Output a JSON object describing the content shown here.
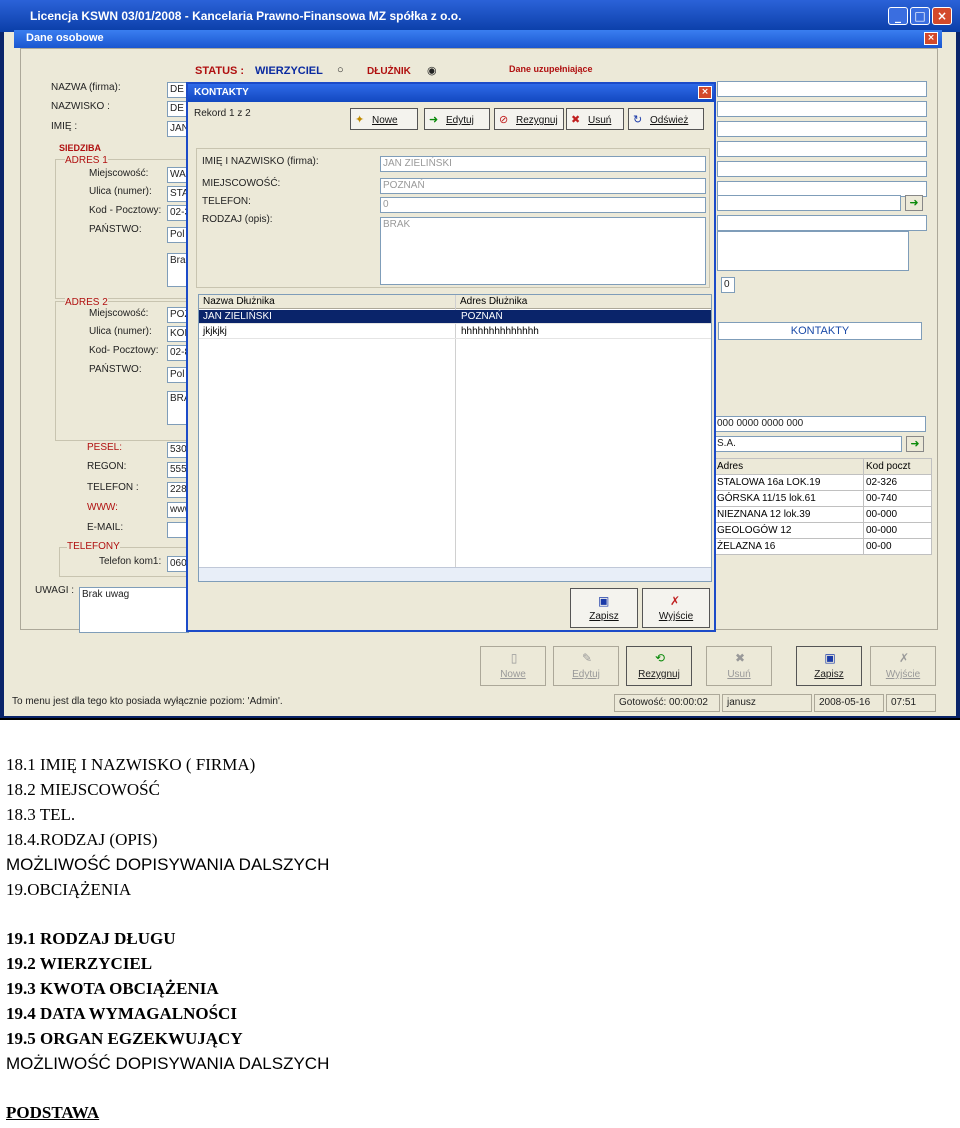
{
  "window": {
    "title": "Licencja KSWN 03/01/2008 - Kancelaria Prawno-Finansowa MZ spółka z o.o.",
    "min": "_",
    "max": "□",
    "close": "×"
  },
  "subwindow": {
    "title": "Dane osobowe",
    "close": "×"
  },
  "form": {
    "status_label": "STATUS :",
    "wierzyciel": "WIERZYCIEL",
    "dluznik": "DŁUŻNIK",
    "dane_uzup": "Dane uzupełniające",
    "nazwa_label": "NAZWA (firma):",
    "nazwa_val": "DE",
    "nazwisko_label": "NAZWISKO :",
    "nazwisko_val": "DE",
    "imie_label": "IMIĘ :",
    "imie_val": "JAN",
    "siedziba": "SIEDZIBA",
    "adres1": "ADRES 1",
    "miejsc_label": "Miejscowość:",
    "miejsc1_val": "WA",
    "ulica_label": "Ulica (numer):",
    "ulica1_val": "STA",
    "kod_label": "Kod - Pocztowy:",
    "kod1_val": "02-3",
    "panstwo_label": "PAŃSTWO:",
    "panstwo1_val": "Pol",
    "opis1_val": "Brak",
    "adres2": "ADRES 2",
    "ulica2_label": "Ulica (numer):",
    "kod2_label": "Kod- Pocztowy:",
    "miejsc2_val": "POZ",
    "ulica2_val": "KOL",
    "kod2_val": "02-8",
    "panstwo2_val": "Pol",
    "opis2_val": "BRA",
    "pesel_label": "PESEL:",
    "pesel_val": "530",
    "regon_label": "REGON:",
    "regon_val": "555",
    "telefon_label": "TELEFON :",
    "telefon_val": "228",
    "www_label": "WWW:",
    "www_val": "www",
    "email_label": "E-MAIL:",
    "telefony": "TELEFONY",
    "telkom_label": "Telefon kom1:",
    "telkom_val": "060",
    "uwagi_label": "UWAGI :",
    "uwagi_val": "Brak uwag",
    "right_num": "0",
    "kontakty": "KONTAKTY",
    "konto_val": "000 0000 0000 000",
    "bank_val": "S.A."
  },
  "right_table": {
    "headers": [
      "Adres",
      "Kod poczt"
    ],
    "rows": [
      [
        "STALOWA 16a LOK.19",
        "02-326"
      ],
      [
        "GÓRSKA 11/15 lok.61",
        "00-740"
      ],
      [
        "NIEZNANA 12 lok.39",
        "00-000"
      ],
      [
        "GEOLOGÓW 12",
        "00-000"
      ],
      [
        "ŻELAZNA 16",
        "00-00"
      ]
    ]
  },
  "bottom_buttons": [
    "Nowe",
    "Edytuj",
    "Rezygnuj",
    "Usuń",
    "Zapisz",
    "Wyjście"
  ],
  "statusbar": {
    "msg": "To menu jest dla tego kto posiada wyłącznie poziom: 'Admin'.",
    "gotowosc": "Gotowość: 00:00:02",
    "user": "janusz",
    "date": "2008-05-16",
    "time": "07:51"
  },
  "dialog": {
    "title": "KONTAKTY",
    "close": "×",
    "rekord": "Rekord 1 z 2",
    "tb_nowe": "Nowe",
    "tb_edytuj": "Edytuj",
    "tb_rezygnuj": "Rezygnuj",
    "tb_usun": "Usuń",
    "tb_odswiez": "Odśwież",
    "imie_label": "IMIĘ I NAZWISKO (firma):",
    "imie_val": "JAN ZIELIŃSKI",
    "miejsc_label": "MIEJSCOWOŚĆ:",
    "miejsc_val": "POZNAŃ",
    "tel_label": "TELEFON:",
    "tel_val": "0",
    "rodzaj_label": "RODZAJ (opis):",
    "rodzaj_val": "BRAK",
    "grid_headers": [
      "Nazwa Dłużnika",
      "Adres Dłużnika"
    ],
    "grid_rows": [
      [
        "JAN ZIELIŃSKI",
        "POZNAŃ"
      ],
      [
        "jkjkjkj",
        "hhhhhhhhhhhhhh"
      ]
    ],
    "btn_zapisz": "Zapisz",
    "btn_wyjscie": "Wyjście"
  },
  "doc_lines": [
    "18.1 IMIĘ I NAZWISKO ( FIRMA)",
    "18.2 MIEJSCOWOŚĆ",
    "18.3 TEL.",
    "18.4.RODZAJ (OPIS)",
    "MOŻLIWOŚĆ DOPISYWANIA DALSZYCH",
    "19.OBCIĄŻENIA",
    "19.1 RODZAJ  DŁUGU",
    "19.2 WIERZYCIEL",
    "19.3 KWOTA OBCIĄŻENIA",
    "19.4 DATA WYMAGALNOŚCI",
    "19.5 ORGAN EGZEKWUJĄCY",
    "MOŻLIWOŚĆ DOPISYWANIA DALSZYCH",
    "PODSTAWA"
  ]
}
